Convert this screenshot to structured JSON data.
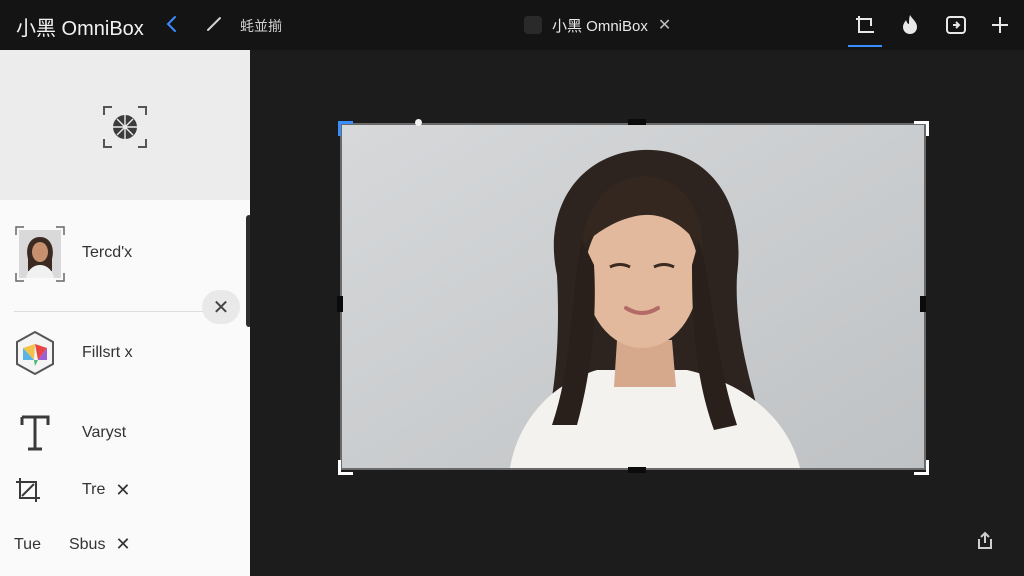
{
  "header": {
    "app_title": "小黑 OmniBox",
    "breadcrumb": "蚝並揃",
    "tab": {
      "label": "小黑 OmniBox",
      "close": "✕"
    },
    "icons": [
      "back-icon",
      "pencil-icon",
      "crop-tool-icon",
      "flame-icon",
      "export-icon",
      "plus-icon"
    ],
    "accent_color": "#3a8dff"
  },
  "sidebar": {
    "items": [
      {
        "label": "Tercd'x",
        "icon": "portrait-thumbnail-icon"
      },
      {
        "label": "Fillsrt x",
        "icon": "color-cube-icon"
      },
      {
        "label": "Varyst",
        "icon": "text-t-icon"
      },
      {
        "label": "Tre",
        "icon": "crop-resize-icon",
        "close": "✕"
      },
      {
        "label": "Tue",
        "label2": "Sbus",
        "close": "✕"
      }
    ],
    "close_button": "✕"
  },
  "canvas": {
    "image": "portrait-photo"
  }
}
